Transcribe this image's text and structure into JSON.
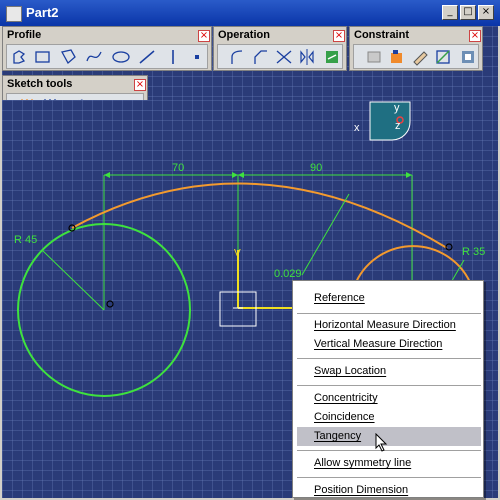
{
  "window": {
    "title": "Part2"
  },
  "toolbars": {
    "profile": {
      "title": "Profile"
    },
    "operation": {
      "title": "Operation"
    },
    "constraint": {
      "title": "Constraint"
    },
    "sketch_tools": {
      "title": "Sketch tools"
    }
  },
  "dimensions": {
    "d70": "70",
    "d90": "90",
    "r45": "R 45",
    "r35": "R 35",
    "d029": "0.029"
  },
  "axis": {
    "x": "x",
    "y": "y",
    "z": "z",
    "v": "V"
  },
  "context_menu": {
    "items": [
      "Reference",
      "Horizontal Measure Direction",
      "Vertical Measure Direction",
      "Swap Location",
      "Concentricity",
      "Coincidence",
      "Tangency",
      "Allow symmetry line",
      "Position Dimension"
    ],
    "highlighted": "Tangency"
  },
  "colors": {
    "background": "#2a3b78",
    "sketch_green": "#3ee23e",
    "arc_orange": "#f39a2e",
    "title_blue": "#0a35a8"
  },
  "icons": [
    "window-icon",
    "minimize-icon",
    "maximize-icon",
    "close-icon",
    "mouse-cursor-icon"
  ]
}
